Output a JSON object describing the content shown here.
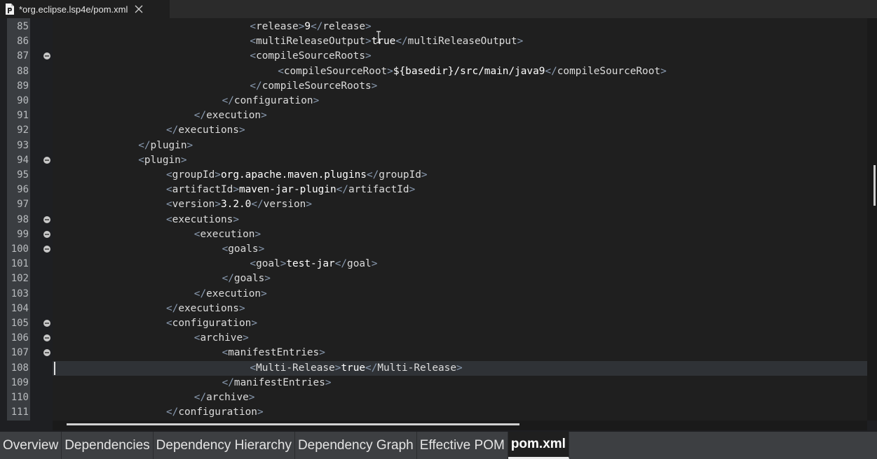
{
  "editor_tab": {
    "title": "*org.eclipse.lsp4e/pom.xml",
    "icon": "xml-file-icon",
    "close_icon": "close-icon"
  },
  "code_lines": [
    {
      "num": "85",
      "indent": 8,
      "fold": false,
      "tokens": [
        [
          "b",
          "<"
        ],
        [
          "t",
          "release"
        ],
        [
          "b",
          ">"
        ],
        [
          "x",
          "9"
        ],
        [
          "b",
          "</"
        ],
        [
          "t",
          "release"
        ],
        [
          "b",
          ">"
        ]
      ]
    },
    {
      "num": "86",
      "indent": 8,
      "fold": false,
      "tokens": [
        [
          "b",
          "<"
        ],
        [
          "t",
          "multiReleaseOutput"
        ],
        [
          "b",
          ">"
        ],
        [
          "x",
          "true"
        ],
        [
          "b",
          "</"
        ],
        [
          "t",
          "multiReleaseOutput"
        ],
        [
          "b",
          ">"
        ]
      ]
    },
    {
      "num": "87",
      "indent": 8,
      "fold": true,
      "tokens": [
        [
          "b",
          "<"
        ],
        [
          "t",
          "compileSourceRoots"
        ],
        [
          "b",
          ">"
        ]
      ]
    },
    {
      "num": "88",
      "indent": 9,
      "fold": false,
      "tokens": [
        [
          "b",
          "<"
        ],
        [
          "t",
          "compileSourceRoot"
        ],
        [
          "b",
          ">"
        ],
        [
          "x",
          "${basedir}/src/main/java9"
        ],
        [
          "b",
          "</"
        ],
        [
          "t",
          "compileSourceRoot"
        ],
        [
          "b",
          ">"
        ]
      ]
    },
    {
      "num": "89",
      "indent": 8,
      "fold": false,
      "tokens": [
        [
          "b",
          "</"
        ],
        [
          "t",
          "compileSourceRoots"
        ],
        [
          "b",
          ">"
        ]
      ]
    },
    {
      "num": "90",
      "indent": 7,
      "fold": false,
      "tokens": [
        [
          "b",
          "</"
        ],
        [
          "t",
          "configuration"
        ],
        [
          "b",
          ">"
        ]
      ]
    },
    {
      "num": "91",
      "indent": 6,
      "fold": false,
      "tokens": [
        [
          "b",
          "</"
        ],
        [
          "t",
          "execution"
        ],
        [
          "b",
          ">"
        ]
      ]
    },
    {
      "num": "92",
      "indent": 5,
      "fold": false,
      "tokens": [
        [
          "b",
          "</"
        ],
        [
          "t",
          "executions"
        ],
        [
          "b",
          ">"
        ]
      ]
    },
    {
      "num": "93",
      "indent": 4,
      "fold": false,
      "tokens": [
        [
          "b",
          "</"
        ],
        [
          "t",
          "plugin"
        ],
        [
          "b",
          ">"
        ]
      ]
    },
    {
      "num": "94",
      "indent": 4,
      "fold": true,
      "tokens": [
        [
          "b",
          "<"
        ],
        [
          "t",
          "plugin"
        ],
        [
          "b",
          ">"
        ]
      ]
    },
    {
      "num": "95",
      "indent": 5,
      "fold": false,
      "tokens": [
        [
          "b",
          "<"
        ],
        [
          "t",
          "groupId"
        ],
        [
          "b",
          ">"
        ],
        [
          "x",
          "org.apache.maven.plugins"
        ],
        [
          "b",
          "</"
        ],
        [
          "t",
          "groupId"
        ],
        [
          "b",
          ">"
        ]
      ]
    },
    {
      "num": "96",
      "indent": 5,
      "fold": false,
      "tokens": [
        [
          "b",
          "<"
        ],
        [
          "t",
          "artifactId"
        ],
        [
          "b",
          ">"
        ],
        [
          "x",
          "maven-jar-plugin"
        ],
        [
          "b",
          "</"
        ],
        [
          "t",
          "artifactId"
        ],
        [
          "b",
          ">"
        ]
      ]
    },
    {
      "num": "97",
      "indent": 5,
      "fold": false,
      "tokens": [
        [
          "b",
          "<"
        ],
        [
          "t",
          "version"
        ],
        [
          "b",
          ">"
        ],
        [
          "x",
          "3.2.0"
        ],
        [
          "b",
          "</"
        ],
        [
          "t",
          "version"
        ],
        [
          "b",
          ">"
        ]
      ]
    },
    {
      "num": "98",
      "indent": 5,
      "fold": true,
      "tokens": [
        [
          "b",
          "<"
        ],
        [
          "t",
          "executions"
        ],
        [
          "b",
          ">"
        ]
      ]
    },
    {
      "num": "99",
      "indent": 6,
      "fold": true,
      "tokens": [
        [
          "b",
          "<"
        ],
        [
          "t",
          "execution"
        ],
        [
          "b",
          ">"
        ]
      ]
    },
    {
      "num": "100",
      "indent": 7,
      "fold": true,
      "tokens": [
        [
          "b",
          "<"
        ],
        [
          "t",
          "goals"
        ],
        [
          "b",
          ">"
        ]
      ]
    },
    {
      "num": "101",
      "indent": 8,
      "fold": false,
      "tokens": [
        [
          "b",
          "<"
        ],
        [
          "t",
          "goal"
        ],
        [
          "b",
          ">"
        ],
        [
          "x",
          "test-jar"
        ],
        [
          "b",
          "</"
        ],
        [
          "t",
          "goal"
        ],
        [
          "b",
          ">"
        ]
      ]
    },
    {
      "num": "102",
      "indent": 7,
      "fold": false,
      "tokens": [
        [
          "b",
          "</"
        ],
        [
          "t",
          "goals"
        ],
        [
          "b",
          ">"
        ]
      ]
    },
    {
      "num": "103",
      "indent": 6,
      "fold": false,
      "tokens": [
        [
          "b",
          "</"
        ],
        [
          "t",
          "execution"
        ],
        [
          "b",
          ">"
        ]
      ]
    },
    {
      "num": "104",
      "indent": 5,
      "fold": false,
      "tokens": [
        [
          "b",
          "</"
        ],
        [
          "t",
          "executions"
        ],
        [
          "b",
          ">"
        ]
      ]
    },
    {
      "num": "105",
      "indent": 5,
      "fold": true,
      "tokens": [
        [
          "b",
          "<"
        ],
        [
          "t",
          "configuration"
        ],
        [
          "b",
          ">"
        ]
      ]
    },
    {
      "num": "106",
      "indent": 6,
      "fold": true,
      "tokens": [
        [
          "b",
          "<"
        ],
        [
          "t",
          "archive"
        ],
        [
          "b",
          ">"
        ]
      ]
    },
    {
      "num": "107",
      "indent": 7,
      "fold": true,
      "tokens": [
        [
          "b",
          "<"
        ],
        [
          "t",
          "manifestEntries"
        ],
        [
          "b",
          ">"
        ]
      ]
    },
    {
      "num": "108",
      "indent": 8,
      "fold": false,
      "current": true,
      "tokens": [
        [
          "b",
          "<"
        ],
        [
          "t",
          "Multi-Release"
        ],
        [
          "b",
          ">"
        ],
        [
          "x",
          "true"
        ],
        [
          "b",
          "</"
        ],
        [
          "t",
          "Multi-Release"
        ],
        [
          "b",
          ">"
        ]
      ]
    },
    {
      "num": "109",
      "indent": 7,
      "fold": false,
      "tokens": [
        [
          "b",
          "</"
        ],
        [
          "t",
          "manifestEntries"
        ],
        [
          "b",
          ">"
        ]
      ]
    },
    {
      "num": "110",
      "indent": 6,
      "fold": false,
      "tokens": [
        [
          "b",
          "</"
        ],
        [
          "t",
          "archive"
        ],
        [
          "b",
          ">"
        ]
      ]
    },
    {
      "num": "111",
      "indent": 5,
      "fold": false,
      "tokens": [
        [
          "b",
          "</"
        ],
        [
          "t",
          "configuration"
        ],
        [
          "b",
          ">"
        ]
      ]
    }
  ],
  "bottom_tabs": [
    {
      "label": "Overview",
      "active": false
    },
    {
      "label": "Dependencies",
      "active": false
    },
    {
      "label": "Dependency Hierarchy",
      "active": false
    },
    {
      "label": "Dependency Graph",
      "active": false
    },
    {
      "label": "Effective POM",
      "active": false
    },
    {
      "label": "pom.xml",
      "active": true
    }
  ],
  "colors": {
    "bracket": "#8a9bb1",
    "tag": "#dcdcdc",
    "text": "#ffffff",
    "current_line": "#2f3236"
  }
}
